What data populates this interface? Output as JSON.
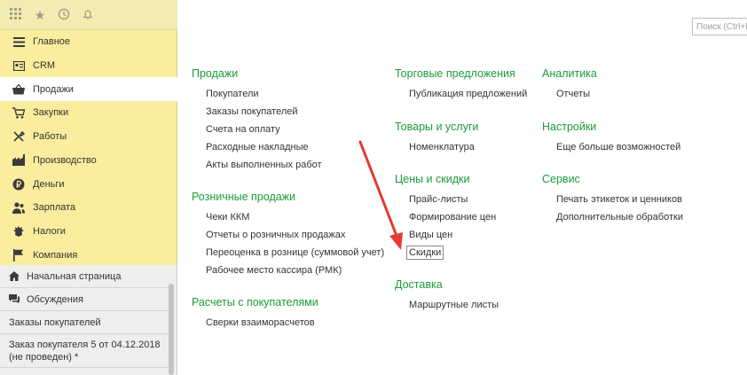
{
  "top_icons": [
    "apps-grid-icon",
    "star-icon",
    "history-icon",
    "bell-icon"
  ],
  "sidebar": {
    "sections": [
      {
        "label": "Главное",
        "icon": "menu-icon",
        "active": false
      },
      {
        "label": "CRM",
        "icon": "crm-icon",
        "active": false
      },
      {
        "label": "Продажи",
        "icon": "basket-icon",
        "active": true
      },
      {
        "label": "Закупки",
        "icon": "cart-icon",
        "active": false
      },
      {
        "label": "Работы",
        "icon": "tools-icon",
        "active": false
      },
      {
        "label": "Производство",
        "icon": "factory-icon",
        "active": false
      },
      {
        "label": "Деньги",
        "icon": "ruble-icon",
        "active": false
      },
      {
        "label": "Зарплата",
        "icon": "people-icon",
        "active": false
      },
      {
        "label": "Налоги",
        "icon": "emblem-icon",
        "active": false
      },
      {
        "label": "Компания",
        "icon": "flag-icon",
        "active": false
      }
    ]
  },
  "open_windows": {
    "items": [
      {
        "label": "Начальная страница",
        "icon": "home-icon"
      },
      {
        "label": "Обсуждения",
        "icon": "chat-icon"
      },
      {
        "label": "Заказы покупателей",
        "icon": ""
      },
      {
        "label": "Заказ покупателя 5 от 04.12.2018 (не проведен) *",
        "icon": ""
      }
    ]
  },
  "search": {
    "placeholder": "Поиск (Ctrl+F)"
  },
  "groups": {
    "sales": {
      "title": "Продажи",
      "links": [
        "Покупатели",
        "Заказы покупателей",
        "Счета на оплату",
        "Расходные накладные",
        "Акты выполненных работ"
      ]
    },
    "retail": {
      "title": "Розничные продажи",
      "links": [
        "Чеки ККМ",
        "Отчеты о розничных продажах",
        "Переоценка в рознице (суммовой учет)",
        "Рабочее место кассира (РМК)"
      ]
    },
    "settlements": {
      "title": "Расчеты с покупателями",
      "links": [
        "Сверки взаиморасчетов"
      ]
    },
    "offers": {
      "title": "Торговые предложения",
      "links": [
        "Публикация предложений"
      ]
    },
    "goods": {
      "title": "Товары и услуги",
      "links": [
        "Номенклатура"
      ]
    },
    "prices": {
      "title": "Цены и скидки",
      "links": [
        "Прайс-листы",
        "Формирование цен",
        "Виды цен",
        "Скидки"
      ]
    },
    "delivery": {
      "title": "Доставка",
      "links": [
        "Маршрутные листы"
      ]
    },
    "analytics": {
      "title": "Аналитика",
      "links": [
        "Отчеты"
      ]
    },
    "settings": {
      "title": "Настройки",
      "links": [
        "Еще больше возможностей"
      ]
    },
    "service": {
      "title": "Сервис",
      "links": [
        "Печать этикеток и ценников",
        "Дополнительные обработки"
      ]
    }
  },
  "colors": {
    "sidebar_bg": "#fbed9e",
    "group_title": "#1d9a3a",
    "arrow": "#e53935"
  }
}
